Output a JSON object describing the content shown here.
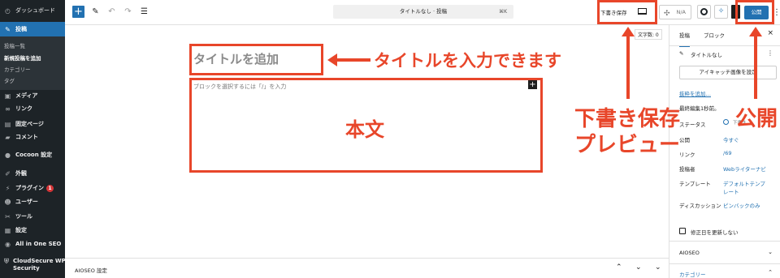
{
  "admin_menu": {
    "dashboard": "ダッシュボード",
    "posts": "投稿",
    "posts_submenu": [
      "投稿一覧",
      "新規投稿を追加",
      "カテゴリー",
      "タグ"
    ],
    "media": "メディア",
    "links": "リンク",
    "pages": "固定ページ",
    "comments": "コメント",
    "cocoon": "Cocoon 設定",
    "appearance": "外観",
    "plugins": "プラグイン",
    "plugins_badge": "1",
    "users": "ユーザー",
    "tools": "ツール",
    "settings": "設定",
    "aioseo": "All in One SEO",
    "cloudsecure_line1": "CloudSecure WP",
    "cloudsecure_line2": "Security"
  },
  "toolbar": {
    "add_icon": "+",
    "pen_icon": "✎",
    "undo_icon": "↶",
    "redo_icon": "↷",
    "list_icon": "☰",
    "doc_title": "タイトルなし · 投稿",
    "shortcut": "⌘K",
    "save_draft": "下書き保存",
    "na_label": "N/A",
    "publish": "公開",
    "more": "⋮"
  },
  "editor": {
    "char_count": "文字数: 0",
    "title_placeholder": "タイトルを追加",
    "block_placeholder": "ブロックを選択するには「/」を入力",
    "block_add": "+"
  },
  "footer": {
    "title": "AIOSEO 設定",
    "controls": [
      "⌃",
      "⌄",
      "⌄"
    ]
  },
  "settings_panel": {
    "tab_post": "投稿",
    "tab_block": "ブロック",
    "close": "×",
    "post_title": "タイトルなし",
    "featured_image": "アイキャッチ画像を設定",
    "add_excerpt": "抜粋を追加…",
    "last_edited": "最終編集1秒前。",
    "rows": [
      {
        "label": "ステータス",
        "value": "下書き"
      },
      {
        "label": "公開",
        "value": "今すぐ"
      },
      {
        "label": "リンク",
        "value": "/69"
      },
      {
        "label": "投稿者",
        "value": "Webライターナビ"
      },
      {
        "label": "テンプレート",
        "value_line1": "デフォルトテンプ",
        "value_line2": "レート"
      },
      {
        "label": "ディスカッション",
        "value": "ピンバックのみ"
      }
    ],
    "checkbox_label": "修正日を更新しない",
    "aioseo": "AIOSEO",
    "category": "カテゴリー"
  },
  "annotations": {
    "title_note": "タイトルを入力できます",
    "body_note": "本文",
    "draft_line1": "下書き保存",
    "draft_line2": "プレビュー",
    "publish_note": "公開",
    "color": "#e8462a"
  }
}
